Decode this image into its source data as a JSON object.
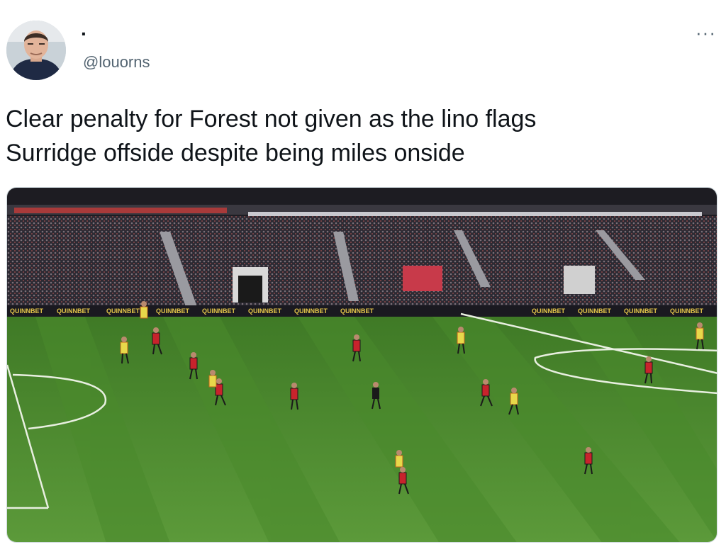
{
  "author": {
    "display_name": "·",
    "handle": "@louorns"
  },
  "tweet": {
    "line1": "Clear penalty for Forest not given as the lino flags",
    "line2": "Surridge offside despite being miles onside"
  },
  "menu": {
    "more_label": "···"
  },
  "media": {
    "ad_text": "QUINNBET",
    "colors": {
      "pitch_light": "#5f9a3a",
      "pitch_dark": "#4d8a2e",
      "home_kit": "#c8232c",
      "away_kit": "#e8d84a",
      "crowd": "#2c2a33"
    }
  }
}
